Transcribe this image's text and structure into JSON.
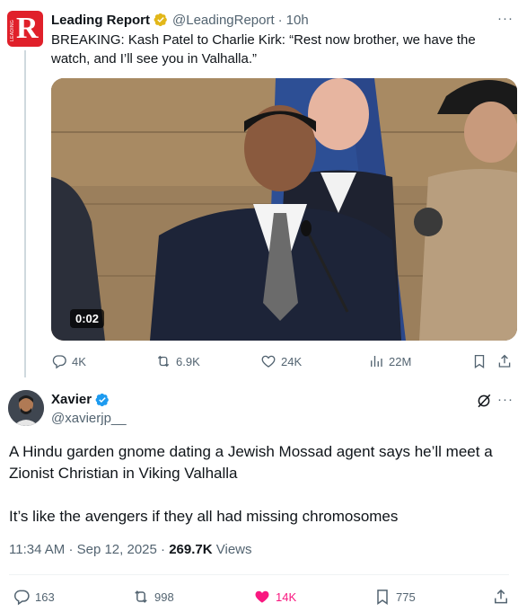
{
  "parent_tweet": {
    "avatar_letter": "R",
    "avatar_side_text": "LEADING",
    "name": "Leading Report",
    "handle": "@LeadingReport",
    "separator": "·",
    "time": "10h",
    "more_label": "···",
    "text": "BREAKING: Kash Patel to Charlie Kirk: “Rest now brother, we have the watch, and I’ll see you in Valhalla.”",
    "video_time": "0:02",
    "actions": {
      "replies": "4K",
      "reposts": "6.9K",
      "likes": "24K",
      "views": "22M"
    }
  },
  "main_tweet": {
    "name": "Xavier",
    "handle": "@xavierjp__",
    "more_label": "···",
    "paragraphs": [
      "A Hindu garden gnome dating a Jewish Mossad agent says he’ll meet a Zionist Christian in Viking Valhalla",
      "It’s like the avengers if they all had missing chromosomes"
    ],
    "time": "11:34 AM",
    "date": "Sep 12, 2025",
    "separator": "·",
    "views_count": "269.7K",
    "views_label": "Views",
    "actions": {
      "replies": "163",
      "reposts": "998",
      "likes": "14K",
      "bookmarks": "775"
    }
  },
  "colors": {
    "text": "#0f1419",
    "secondary": "#536471",
    "like_pink": "#f91880",
    "verified_blue": "#1d9bf0",
    "verified_gold": "#e2b719",
    "brand_red": "#e0202a"
  },
  "icons": [
    "verified-gold-icon",
    "verified-blue-icon",
    "reply-icon",
    "repost-icon",
    "like-icon",
    "views-icon",
    "bookmark-icon",
    "share-icon",
    "grok-icon"
  ]
}
